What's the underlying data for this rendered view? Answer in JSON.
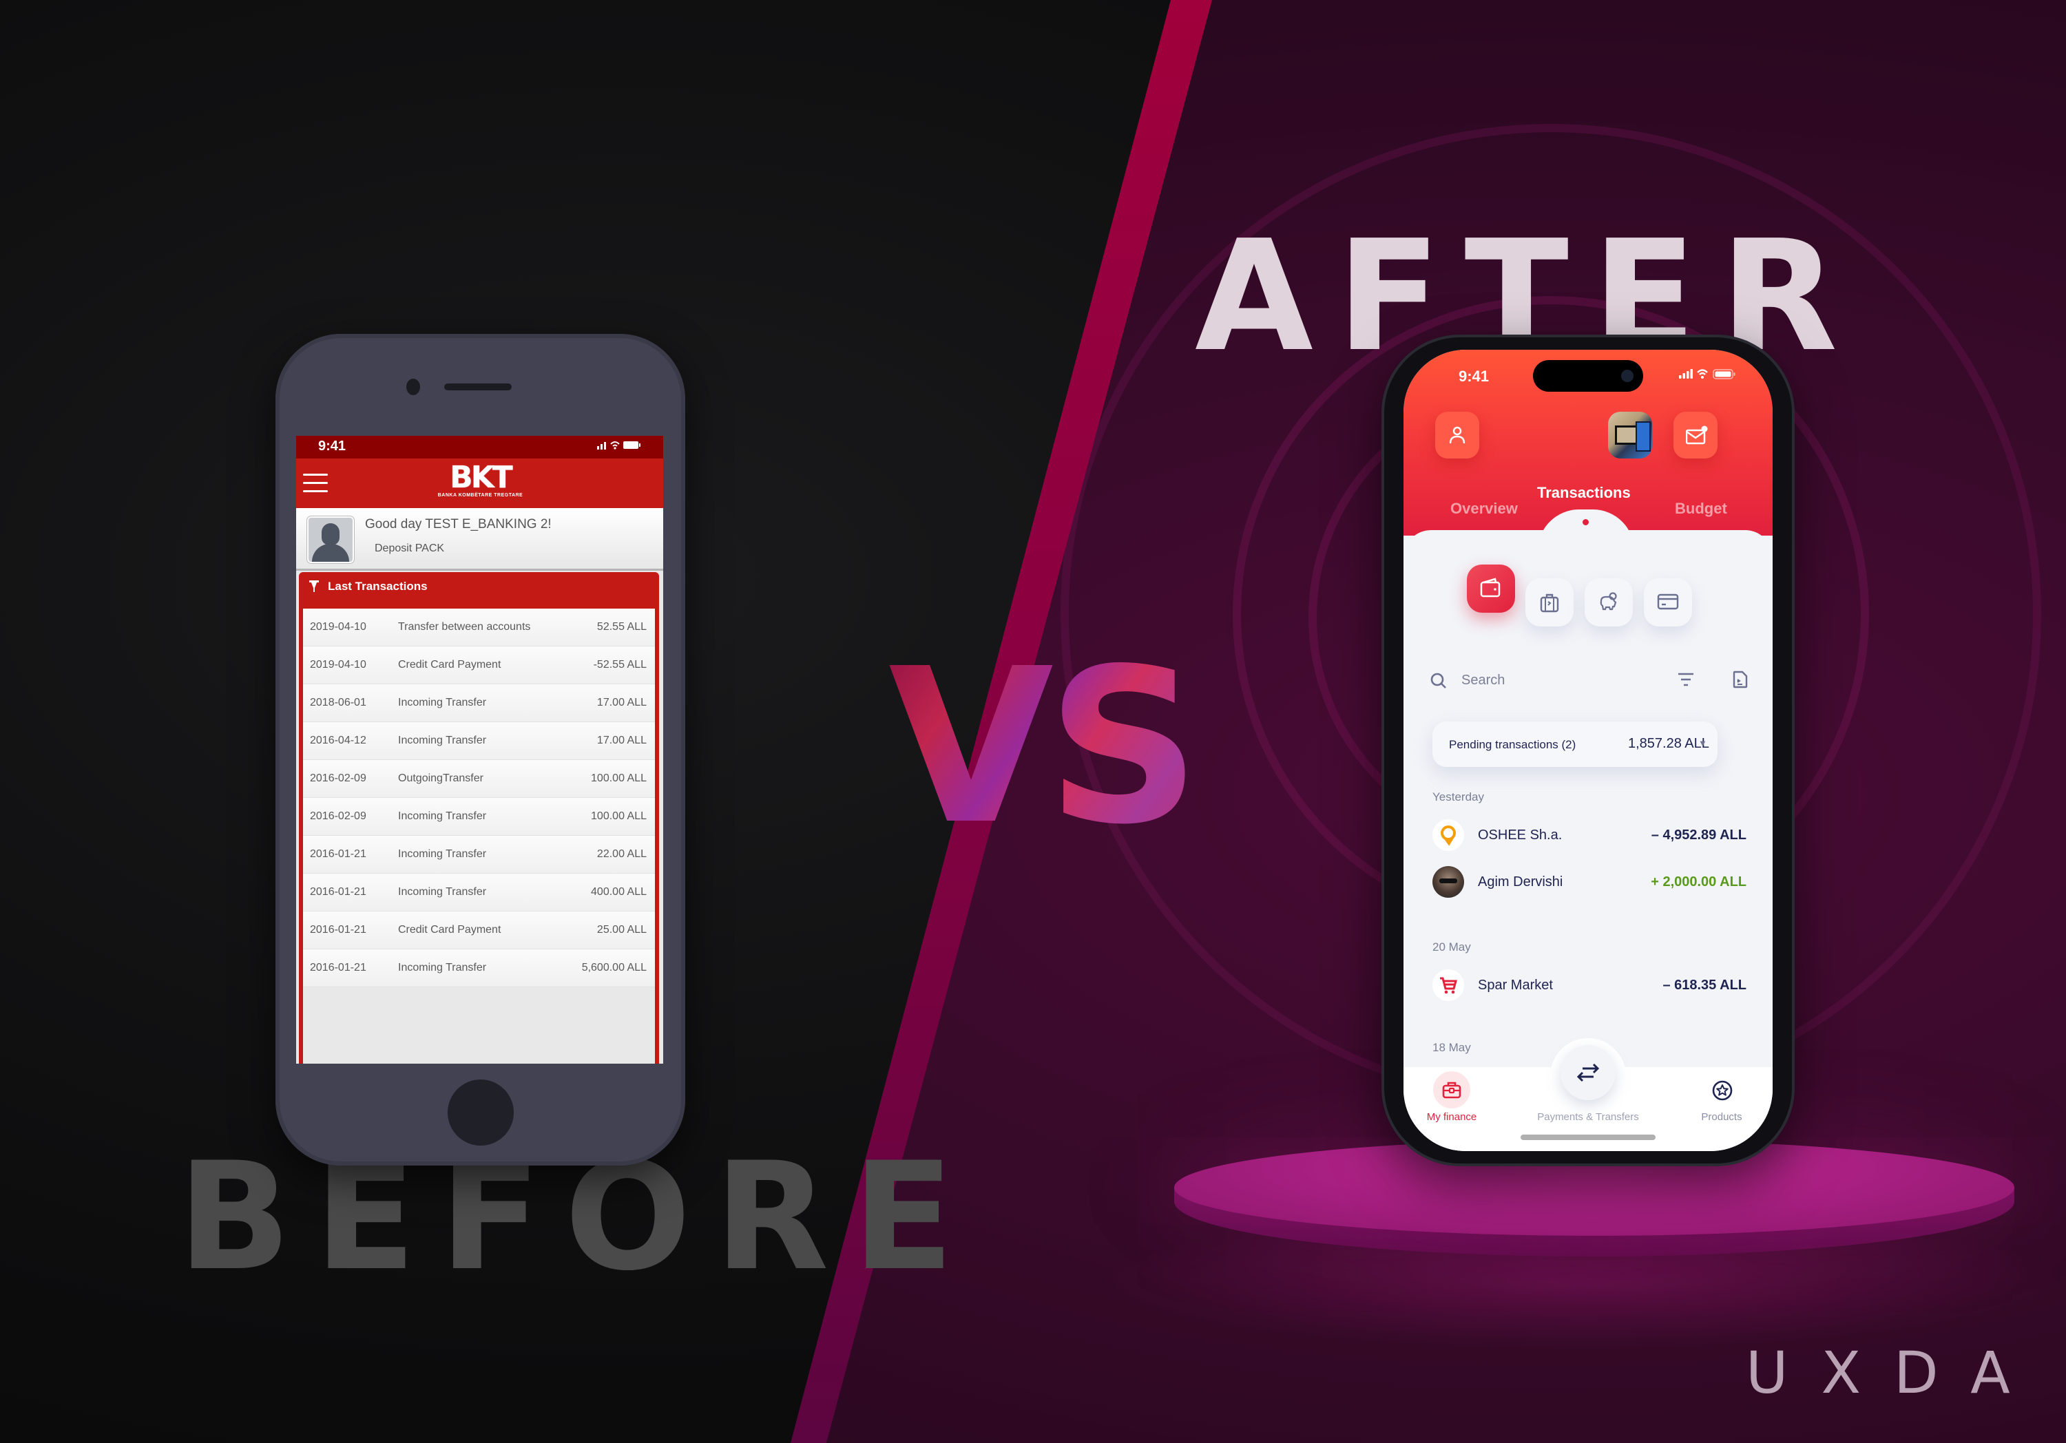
{
  "headlines": {
    "after": "AFTER",
    "before": "BEFORE",
    "versus": "VS"
  },
  "brand": {
    "logo": "UXDA",
    "colors": {
      "old_red": "#c41a16",
      "new_red": "#e2213d",
      "positive_green": "#5a9a1a",
      "dark_navy": "#1f2350",
      "bg_purple": "#3a0a2b"
    }
  },
  "before_app": {
    "status_time": "9:41",
    "status_icons": "signal wifi battery",
    "menu_icon": "hamburger-icon",
    "logo_mark": "BKT",
    "logo_subtitle": "BANKA KOMBËTARE TREGTARE",
    "greeting": "Good day TEST E_BANKING 2!",
    "package": "Deposit PACK",
    "panel_title": "Last Transactions",
    "transactions": [
      {
        "date": "2019-04-10",
        "description": "Transfer between accounts",
        "amount": "52.55 ALL"
      },
      {
        "date": "2019-04-10",
        "description": "Credit Card Payment",
        "amount": "-52.55 ALL"
      },
      {
        "date": "2018-06-01",
        "description": "Incoming Transfer",
        "amount": "17.00 ALL"
      },
      {
        "date": "2016-04-12",
        "description": "Incoming Transfer",
        "amount": "17.00 ALL"
      },
      {
        "date": "2016-02-09",
        "description": "OutgoingTransfer",
        "amount": "100.00 ALL"
      },
      {
        "date": "2016-02-09",
        "description": "Incoming Transfer",
        "amount": "100.00 ALL"
      },
      {
        "date": "2016-01-21",
        "description": "Incoming Transfer",
        "amount": "22.00 ALL"
      },
      {
        "date": "2016-01-21",
        "description": "Incoming Transfer",
        "amount": "400.00 ALL"
      },
      {
        "date": "2016-01-21",
        "description": "Credit Card Payment",
        "amount": "25.00 ALL"
      },
      {
        "date": "2016-01-21",
        "description": "Incoming Transfer",
        "amount": "5,600.00 ALL"
      }
    ]
  },
  "after_app": {
    "status_time": "9:41",
    "status_icons": "▂▄▆ ◠ ▭",
    "header_buttons": [
      "profile-icon",
      "promo-thumbnail",
      "mail-notification-icon"
    ],
    "tabs": [
      {
        "label": "Overview",
        "active": false
      },
      {
        "label": "Transactions",
        "active": true
      },
      {
        "label": "Budget",
        "active": false
      }
    ],
    "categories": [
      {
        "icon": "wallet-icon",
        "active": true
      },
      {
        "icon": "travel-bag-icon",
        "active": false
      },
      {
        "icon": "piggy-bank-icon",
        "active": false
      },
      {
        "icon": "credit-card-icon",
        "active": false
      }
    ],
    "search": {
      "placeholder": "Search",
      "value": ""
    },
    "pending": {
      "label": "Pending transactions (2)",
      "amount": "1,857.28 ALL",
      "caret": "▼"
    },
    "groups": [
      {
        "label": "Yesterday",
        "items": [
          {
            "name": "OSHEE Sh.a.",
            "amount": "– 4,952.89 ALL",
            "direction": "out",
            "icon": "oshee-logo-icon"
          },
          {
            "name": "Agim Dervishi",
            "amount": "+ 2,000.00 ALL",
            "direction": "in",
            "icon": "person-avatar"
          }
        ]
      },
      {
        "label": "20 May",
        "items": [
          {
            "name": "Spar Market",
            "amount": "– 618.35 ALL",
            "direction": "out",
            "icon": "shopping-cart-icon"
          }
        ]
      },
      {
        "label": "18 May",
        "items": []
      }
    ],
    "bottom_nav": [
      {
        "label": "My finance",
        "icon": "briefcase-icon",
        "active": true
      },
      {
        "label": "Payments & Transfers",
        "icon": "transfer-arrows-icon",
        "active": false
      },
      {
        "label": "Products",
        "icon": "star-circle-icon",
        "active": false
      }
    ]
  }
}
